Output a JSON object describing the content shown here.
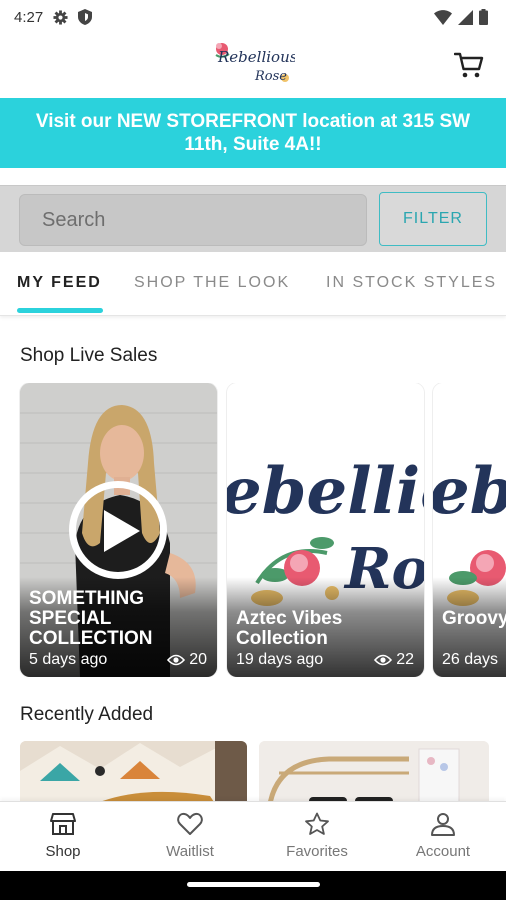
{
  "status_bar": {
    "time": "4:27",
    "icons": [
      "gear-icon",
      "shield-icon",
      "wifi-icon",
      "signal-icon",
      "battery-icon"
    ]
  },
  "header": {
    "logo_text_1": "Rebellious",
    "logo_text_2": "Rose",
    "cart_icon": "cart-icon"
  },
  "banner": {
    "text": "Visit our NEW STOREFRONT location at 315 SW 11th, Suite 4A!!",
    "color": "#2bd2dc"
  },
  "search": {
    "placeholder": "Search",
    "filter_label": "FILTER"
  },
  "tabs": [
    {
      "label": "MY FEED",
      "active": true
    },
    {
      "label": "SHOP THE LOOK",
      "active": false
    },
    {
      "label": "IN STOCK STYLES",
      "active": false
    }
  ],
  "live_sales": {
    "title": "Shop Live Sales",
    "cards": [
      {
        "title": "SOMETHING SPECIAL COLLECTION",
        "age": "5 days ago",
        "views": "20"
      },
      {
        "title": "Aztec Vibes Collection",
        "age": "19 days ago",
        "views": "22"
      },
      {
        "title": "Groovy Collection",
        "age": "26 days"
      }
    ]
  },
  "recently_added": {
    "title": "Recently Added"
  },
  "bottom_nav": [
    {
      "label": "Shop",
      "icon": "shop-icon",
      "active": true
    },
    {
      "label": "Waitlist",
      "icon": "heart-icon",
      "active": false
    },
    {
      "label": "Favorites",
      "icon": "star-icon",
      "active": false
    },
    {
      "label": "Account",
      "icon": "account-icon",
      "active": false
    }
  ],
  "colors": {
    "accent": "#2bd2dc",
    "filter_border": "#3fbcc4",
    "logo_navy": "#23345a"
  }
}
